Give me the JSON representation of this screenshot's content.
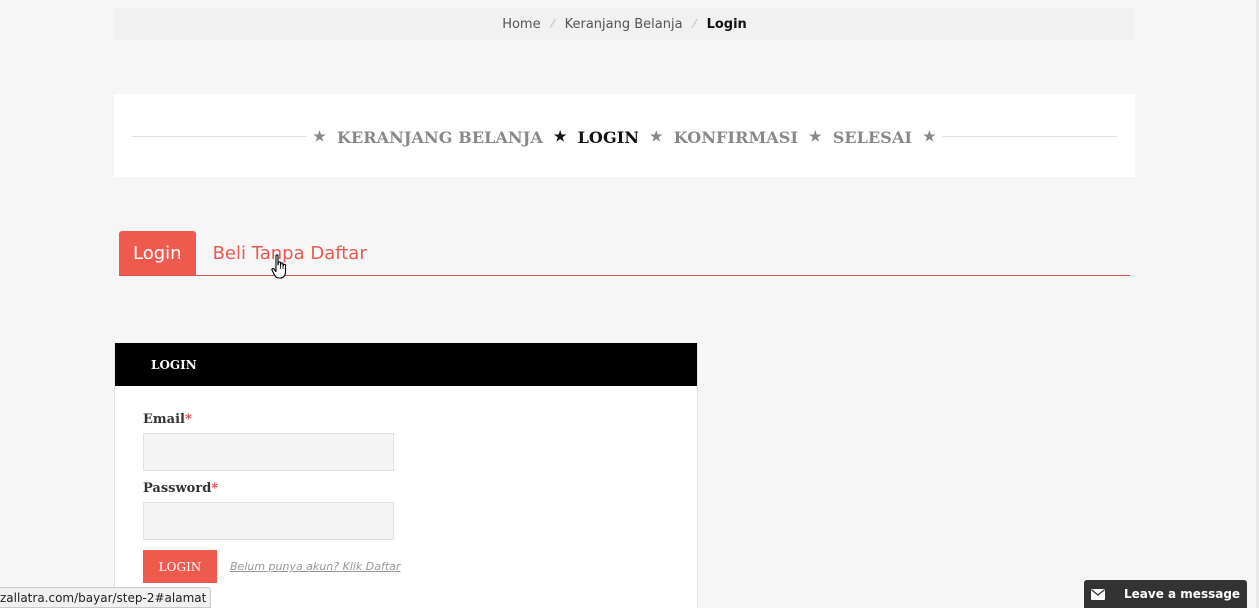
{
  "breadcrumb": {
    "items": [
      "Home",
      "Keranjang Belanja"
    ],
    "current": "Login"
  },
  "steps": {
    "items": [
      {
        "label": "KERANJANG BELANJA",
        "active": false
      },
      {
        "label": "LOGIN",
        "active": true
      },
      {
        "label": "KONFIRMASI",
        "active": false
      },
      {
        "label": "SELESAI",
        "active": false
      }
    ]
  },
  "tabs": {
    "login": "Login",
    "guest": "Beli Tanpa Daftar"
  },
  "login_card": {
    "title": "LOGIN",
    "email_label": "Email",
    "password_label": "Password",
    "required_mark": "*",
    "email_value": "",
    "password_value": "",
    "submit_label": "LOGIN",
    "register_hint": "Belum punya akun? Klik Daftar"
  },
  "status_bar": {
    "url": "zallatra.com/bayar/step-2#alamat"
  },
  "chat": {
    "label": "Leave a message"
  },
  "colors": {
    "accent": "#ef5a4e",
    "header_bg": "#000000",
    "page_bg": "#f6f6f6"
  }
}
